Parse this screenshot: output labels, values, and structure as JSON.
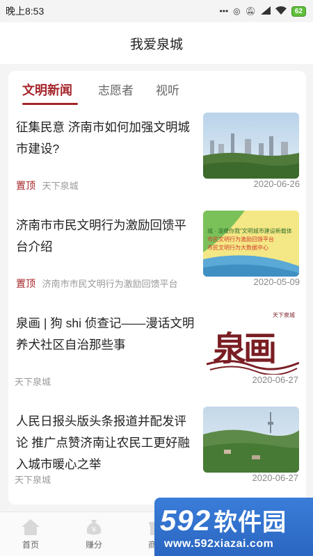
{
  "status_bar": {
    "time": "晚上8:53",
    "battery": "62"
  },
  "header": {
    "title": "我爱泉城"
  },
  "tabs": [
    {
      "label": "文明新闻",
      "active": true
    },
    {
      "label": "志愿者",
      "active": false
    },
    {
      "label": "视听",
      "active": false
    }
  ],
  "news": [
    {
      "title": "征集民意 济南市如何加强文明城市建设?",
      "pin": "置顶",
      "source": "天下泉城",
      "date": "2020-06-26",
      "thumb": "city-aerial"
    },
    {
      "title": "济南市市民文明行为激励回馈平台介绍",
      "pin": "置顶",
      "source": "济南市市民文明行为激励回馈平台",
      "date": "2020-05-09",
      "thumb": "platform-banner",
      "thumb_text": [
        "城 · 温暖你我”文明城市建设新载体",
        "市民文明行为激励回馈平台",
        "市民文明行为大数据中心"
      ]
    },
    {
      "title": "泉画 | 狗 shi 侦查记——漫话文明养犬社区自治那些事",
      "pin": "",
      "source": "天下泉城",
      "date": "2020-06-27",
      "thumb": "calligraphy-logo",
      "thumb_text": [
        "天下泉城",
        "泉画"
      ]
    },
    {
      "title": "人民日报头版头条报道并配发评论 推广点赞济南让农民工更好融入城市暖心之举",
      "pin": "",
      "source": "天下泉城",
      "date": "2020-06-27",
      "thumb": "city-tower"
    }
  ],
  "tabbar": [
    {
      "label": "首页",
      "icon": "home-icon"
    },
    {
      "label": "赚分",
      "icon": "coin-bag-icon"
    },
    {
      "label": "商城",
      "icon": "shop-icon"
    }
  ],
  "watermark": {
    "logo_num": "592",
    "logo_cn": "软件园",
    "url": "www.592xiazai.com"
  }
}
